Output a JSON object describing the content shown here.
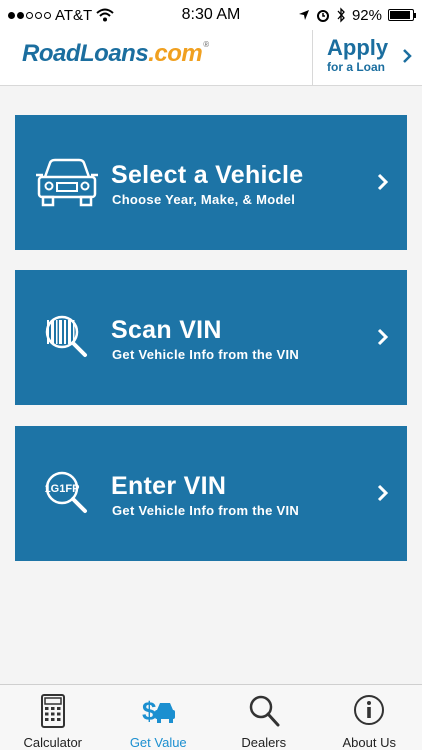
{
  "status_bar": {
    "carrier": "AT&T",
    "time": "8:30 AM",
    "battery": "92%",
    "battery_level": 0.92,
    "signal_bars": 2,
    "signal_total": 5
  },
  "header": {
    "logo_road": "RoadLoans",
    "logo_com": ".com",
    "logo_mark": "®",
    "apply_title": "Apply",
    "apply_sub": "for a Loan"
  },
  "options": [
    {
      "title": "Select a Vehicle",
      "subtitle": "Choose Year, Make, & Model",
      "icon": "car-icon"
    },
    {
      "title": "Scan VIN",
      "subtitle": "Get Vehicle Info from the VIN",
      "icon": "barcode-magnifier-icon"
    },
    {
      "title": "Enter VIN",
      "subtitle": "Get Vehicle Info from the VIN",
      "icon": "vin-magnifier-icon",
      "icon_text": "1G1FP"
    }
  ],
  "tabs": [
    {
      "label": "Calculator",
      "icon": "calculator-icon",
      "active": false
    },
    {
      "label": "Get Value",
      "icon": "dollar-car-icon",
      "active": true
    },
    {
      "label": "Dealers",
      "icon": "search-icon",
      "active": false
    },
    {
      "label": "About Us",
      "icon": "info-icon",
      "active": false
    }
  ],
  "colors": {
    "primary": "#1d74a6",
    "brand_blue": "#1b6e9f",
    "brand_orange": "#f0a020",
    "active_tab": "#1b8fd0"
  }
}
